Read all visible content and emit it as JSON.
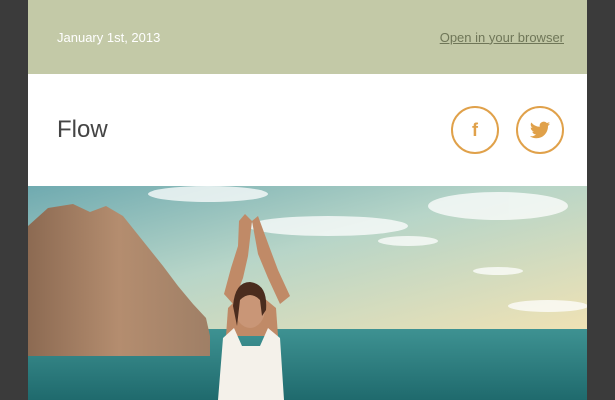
{
  "topbar": {
    "date": "January 1st, 2013",
    "browser_link": "Open in your browser"
  },
  "header": {
    "brand": "Flow",
    "socials": [
      {
        "label": "f",
        "icon": "facebook-icon"
      },
      {
        "icon": "twitter-icon"
      }
    ]
  },
  "hero": {
    "image": "yoga-by-sea",
    "colors": {
      "sky": "#a9cfc8",
      "sea": "#2b7f80",
      "rock": "#a17b60"
    }
  },
  "colors": {
    "accent": "#e0a14a",
    "topbar": "#c3c9a7",
    "frame": "#3b3b3b"
  }
}
